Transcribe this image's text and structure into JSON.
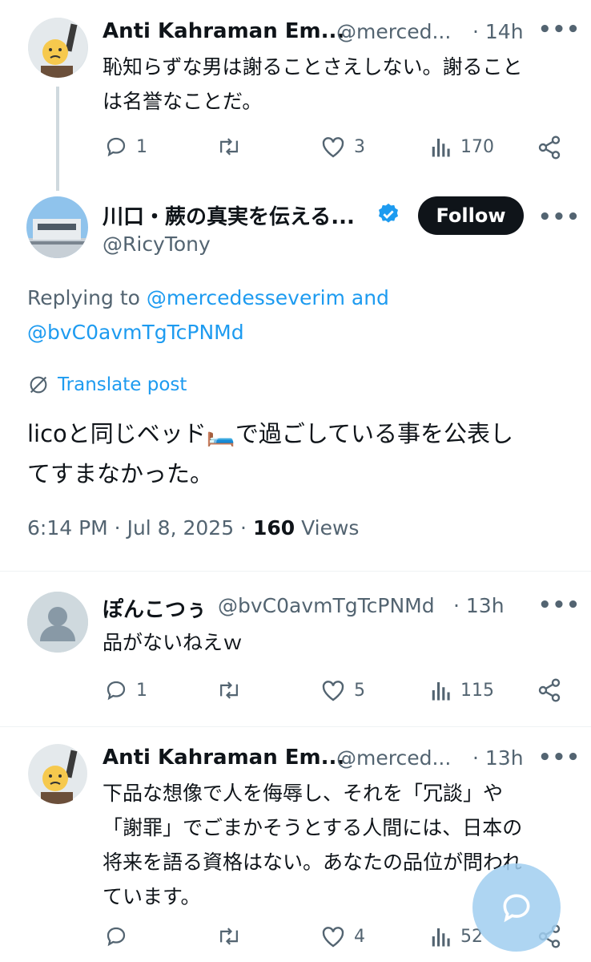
{
  "colors": {
    "accent": "#1d9bf0",
    "muted": "#536471",
    "text": "#0f1419",
    "verified": "#1d9bf0"
  },
  "tweets": [
    {
      "name": "Anti Kahraman Em...",
      "handle": "@merced...",
      "time": "· 14h",
      "lines": [
        "恥知らずな男は謝ることさえしない。謝ること",
        "は名誉なことだ。"
      ],
      "replies": "1",
      "retweets": "",
      "likes": "3",
      "views": "170"
    },
    {
      "name": "ぽんこつぅ",
      "handle": "@bvC0avmTgTcPNMd",
      "time": "· 13h",
      "lines": [
        "品がないねえｗ"
      ],
      "replies": "1",
      "retweets": "",
      "likes": "5",
      "views": "115"
    },
    {
      "name": "Anti Kahraman Em...",
      "handle": "@merced...",
      "time": "· 13h",
      "lines": [
        "下品な想像で人を侮辱し、それを「冗談」や",
        "「謝罪」でごまかそうとする人間には、日本の",
        "将来を語る資格はない。あなたの品位が問われ",
        "ています。"
      ],
      "replies": "",
      "retweets": "",
      "likes": "4",
      "views": "52"
    }
  ],
  "main": {
    "name": "川口・蕨の真実を伝える...",
    "handle": "@RicyTony",
    "follow_label": "Follow",
    "replying_prefix": "Replying to",
    "replying_user1": "@mercedesseverim",
    "replying_and": "and",
    "replying_user2": "@bvC0avmTgTcPNMd",
    "translate_label": "Translate post",
    "line1_a": "licoと同じベッド",
    "line1_emoji": "🛏️",
    "line1_b": "で過ごしている事を公表し",
    "line2": "てすまなかった。",
    "timestamp": "6:14 PM · Jul 8, 2025 · ",
    "views_count": "160",
    "views_label": "Views"
  },
  "icons": {
    "more": "more-icon",
    "reply": "reply-icon",
    "retweet": "retweet-icon",
    "like": "like-icon",
    "views": "views-icon",
    "share": "share-icon",
    "verified": "verified-badge-icon",
    "translate": "globe-icon",
    "compose": "compose-reply-icon"
  }
}
